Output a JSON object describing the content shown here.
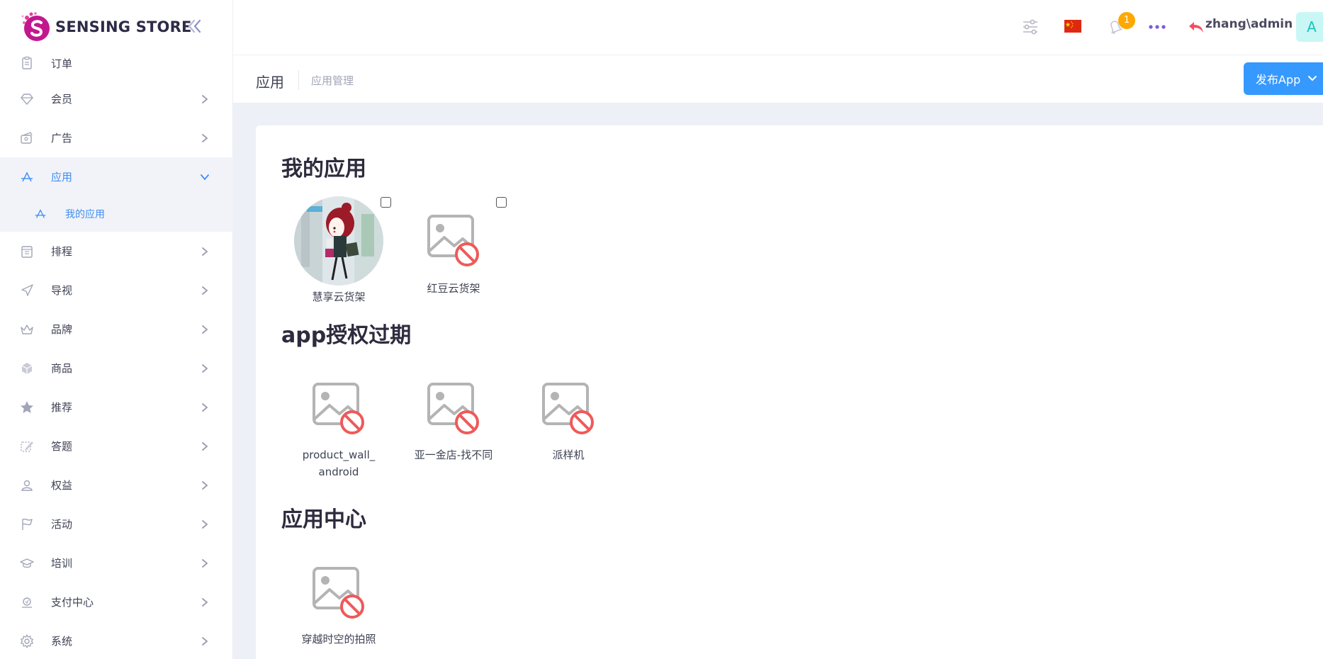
{
  "brand": {
    "name": "SENSING STORE"
  },
  "sidebar": {
    "items": [
      {
        "label": "订单",
        "icon": "clipboard-icon",
        "arrow": false
      },
      {
        "label": "会员",
        "icon": "diamond-icon",
        "arrow": true
      },
      {
        "label": "广告",
        "icon": "ad-icon",
        "arrow": true
      },
      {
        "label": "应用",
        "icon": "app-store-icon",
        "arrow": true,
        "active": true,
        "expanded": true
      },
      {
        "label": "排程",
        "icon": "calendar-icon",
        "arrow": true
      },
      {
        "label": "导视",
        "icon": "navigation-icon",
        "arrow": true
      },
      {
        "label": "品牌",
        "icon": "crown-icon",
        "arrow": true
      },
      {
        "label": "商品",
        "icon": "box-icon",
        "arrow": true
      },
      {
        "label": "推荐",
        "icon": "star-icon",
        "arrow": true
      },
      {
        "label": "答题",
        "icon": "edit-icon",
        "arrow": true
      },
      {
        "label": "权益",
        "icon": "user-icon",
        "arrow": true
      },
      {
        "label": "活动",
        "icon": "flag-icon",
        "arrow": true
      },
      {
        "label": "培训",
        "icon": "graduation-icon",
        "arrow": true
      },
      {
        "label": "支付中心",
        "icon": "payment-icon",
        "arrow": true
      },
      {
        "label": "系统",
        "icon": "gear-icon",
        "arrow": true
      }
    ],
    "sub_item": {
      "label": "我的应用",
      "icon": "app-store-icon"
    }
  },
  "topbar": {
    "notification_count": "1",
    "user": "zhang\\admin",
    "avatar_letter": "A"
  },
  "subheader": {
    "title": "应用",
    "breadcrumb": "应用管理",
    "publish_button": "发布App"
  },
  "sections": {
    "my_apps": {
      "title": "我的应用",
      "apps": [
        {
          "name": "慧享云货架"
        },
        {
          "name": "红豆云货架"
        }
      ]
    },
    "expired": {
      "title": "app授权过期",
      "apps": [
        {
          "name": "product_wall_ android"
        },
        {
          "name": "亚一金店-找不同"
        },
        {
          "name": "派样机"
        }
      ]
    },
    "center": {
      "title": "应用中心",
      "apps": [
        {
          "name": "穿越时空的拍照"
        }
      ]
    }
  },
  "colors": {
    "accent": "#3699ff",
    "active_text": "#3f8ef3",
    "badge": "#ffa800",
    "content_bg": "#eef0f8"
  }
}
